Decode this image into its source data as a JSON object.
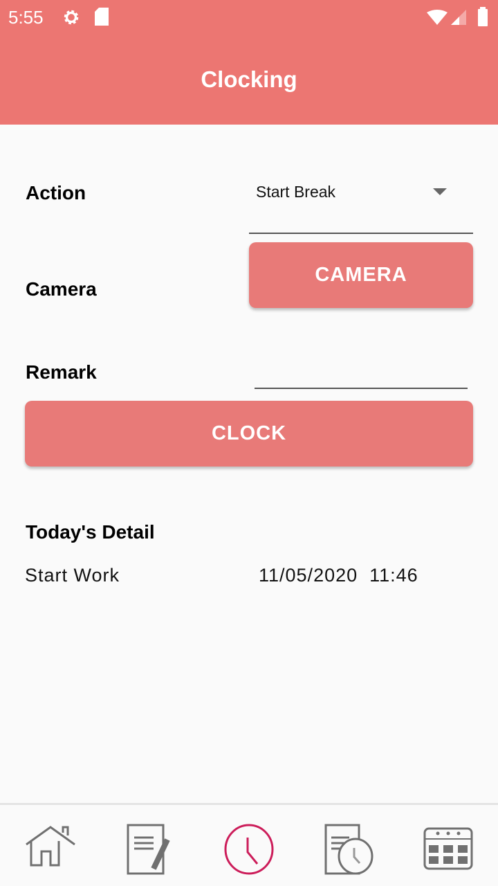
{
  "status": {
    "time": "5:55",
    "icons": [
      "gear-icon",
      "sd-card-icon",
      "wifi-icon",
      "signal-icon",
      "battery-icon"
    ]
  },
  "header": {
    "title": "Clocking"
  },
  "form": {
    "action_label": "Action",
    "action_value": "Start Break",
    "camera_label": "Camera",
    "camera_button": "CAMERA",
    "remark_label": "Remark",
    "remark_value": "",
    "clock_button": "CLOCK"
  },
  "detail": {
    "title": "Today's Detail",
    "rows": [
      {
        "action": "Start Work",
        "datetime": "11/05/2020  11:46"
      }
    ]
  },
  "nav": {
    "items": [
      "home-icon",
      "edit-document-icon",
      "clock-icon",
      "timesheet-icon",
      "calendar-icon"
    ],
    "active": "clock-icon"
  },
  "colors": {
    "primary": "#ec7672",
    "button": "#e87a78",
    "active_nav": "#cc1d5a",
    "nav_icon": "#707070"
  }
}
